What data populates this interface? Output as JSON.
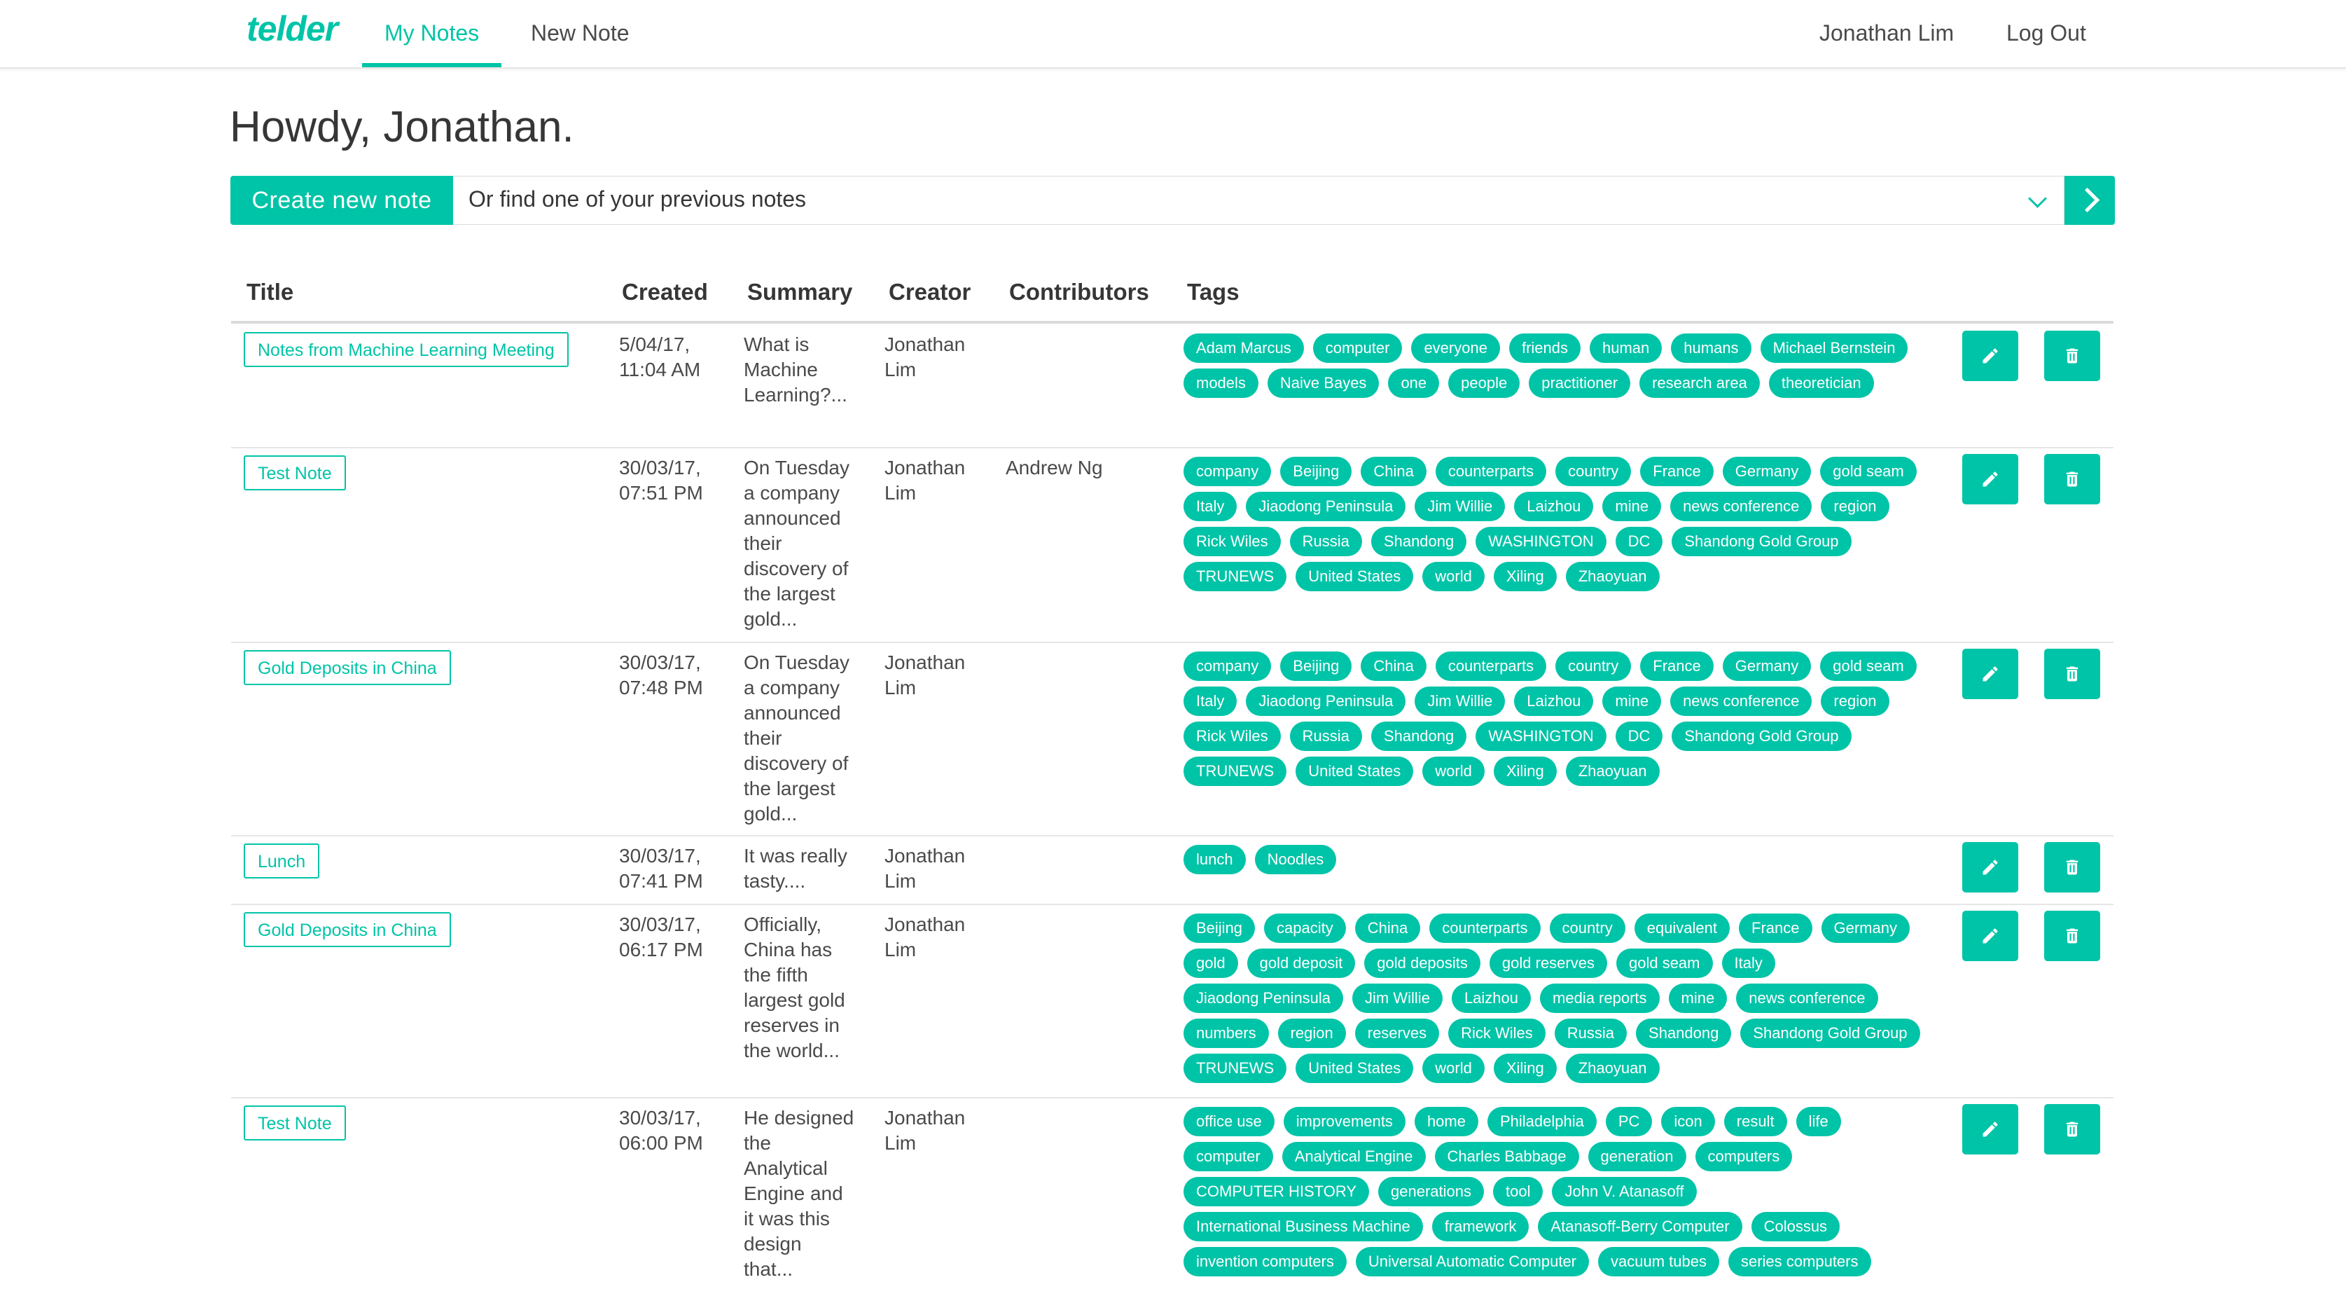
{
  "nav": {
    "logo": "telder",
    "tabs": [
      {
        "label": "My Notes",
        "active": true
      },
      {
        "label": "New Note",
        "active": false
      }
    ],
    "user": "Jonathan Lim",
    "logout": "Log Out"
  },
  "greeting": "Howdy, Jonathan.",
  "search": {
    "create_label": "Create new note",
    "placeholder": "Or find one of your previous notes"
  },
  "columns": [
    "Title",
    "Created",
    "Summary",
    "Creator",
    "Contributors",
    "Tags"
  ],
  "rows": [
    {
      "title": "Notes from Machine Learning Meeting",
      "created": [
        "5/04/17,",
        "11:04 AM"
      ],
      "summary": [
        "What is",
        "Machine",
        "Learning?..."
      ],
      "creator": [
        "Jonathan",
        "Lim"
      ],
      "contributors": "",
      "tags": [
        "Adam Marcus",
        "computer",
        "everyone",
        "friends",
        "human",
        "humans",
        "Michael Bernstein",
        "models",
        "Naive Bayes",
        "one",
        "people",
        "practitioner",
        "research area",
        "theoretician"
      ]
    },
    {
      "title": "Test Note",
      "created": [
        "30/03/17,",
        "07:51 PM"
      ],
      "summary": [
        "On Tuesday",
        "a company",
        "announced",
        "their",
        "discovery of",
        "the largest",
        "gold..."
      ],
      "creator": [
        "Jonathan",
        "Lim"
      ],
      "contributors": "Andrew Ng",
      "tags": [
        "company",
        "Beijing",
        "China",
        "counterparts",
        "country",
        "France",
        "Germany",
        "gold seam",
        "Italy",
        "Jiaodong Peninsula",
        "Jim Willie",
        "Laizhou",
        "mine",
        "news conference",
        "region",
        "Rick Wiles",
        "Russia",
        "Shandong",
        "WASHINGTON",
        "DC",
        "Shandong Gold Group",
        "TRUNEWS",
        "United States",
        "world",
        "Xiling",
        "Zhaoyuan"
      ]
    },
    {
      "title": "Gold Deposits in China",
      "created": [
        "30/03/17,",
        "07:48 PM"
      ],
      "summary": [
        "On Tuesday",
        "a company",
        "announced",
        "their",
        "discovery of",
        "the largest",
        "gold..."
      ],
      "creator": [
        "Jonathan",
        "Lim"
      ],
      "contributors": "",
      "tags": [
        "company",
        "Beijing",
        "China",
        "counterparts",
        "country",
        "France",
        "Germany",
        "gold seam",
        "Italy",
        "Jiaodong Peninsula",
        "Jim Willie",
        "Laizhou",
        "mine",
        "news conference",
        "region",
        "Rick Wiles",
        "Russia",
        "Shandong",
        "WASHINGTON",
        "DC",
        "Shandong Gold Group",
        "TRUNEWS",
        "United States",
        "world",
        "Xiling",
        "Zhaoyuan"
      ]
    },
    {
      "title": "Lunch",
      "created": [
        "30/03/17,",
        "07:41 PM"
      ],
      "summary": [
        "It was really",
        "tasty...."
      ],
      "creator": [
        "Jonathan",
        "Lim"
      ],
      "contributors": "",
      "tags": [
        "lunch",
        "Noodles"
      ]
    },
    {
      "title": "Gold Deposits in China",
      "created": [
        "30/03/17,",
        "06:17 PM"
      ],
      "summary": [
        "Officially,",
        "China has",
        "the fifth",
        "largest gold",
        "reserves in",
        "the world..."
      ],
      "creator": [
        "Jonathan",
        "Lim"
      ],
      "contributors": "",
      "tags": [
        "Beijing",
        "capacity",
        "China",
        "counterparts",
        "country",
        "equivalent",
        "France",
        "Germany",
        "gold",
        "gold deposit",
        "gold deposits",
        "gold reserves",
        "gold seam",
        "Italy",
        "Jiaodong Peninsula",
        "Jim Willie",
        "Laizhou",
        "media reports",
        "mine",
        "news conference",
        "numbers",
        "region",
        "reserves",
        "Rick Wiles",
        "Russia",
        "Shandong",
        "Shandong Gold Group",
        "TRUNEWS",
        "United States",
        "world",
        "Xiling",
        "Zhaoyuan"
      ]
    },
    {
      "title": "Test Note",
      "created": [
        "30/03/17,",
        "06:00 PM"
      ],
      "summary": [
        "He designed",
        "the",
        "Analytical",
        "Engine and",
        "it was this",
        "design",
        "that..."
      ],
      "creator": [
        "Jonathan",
        "Lim"
      ],
      "contributors": "",
      "tags": [
        "office use",
        "improvements",
        "home",
        "Philadelphia",
        "PC",
        "icon",
        "result",
        "life",
        "computer",
        "Analytical Engine",
        "Charles Babbage",
        "generation",
        "computers",
        "COMPUTER HISTORY",
        "generations",
        "tool",
        "John V. Atanasoff",
        "International Business Machine",
        "framework",
        "Atanasoff-Berry Computer",
        "Colossus",
        "invention computers",
        "Universal Automatic Computer",
        "vacuum tubes",
        "series computers"
      ]
    }
  ]
}
